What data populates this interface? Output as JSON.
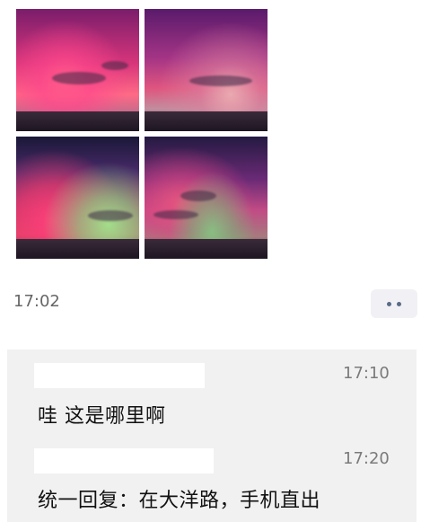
{
  "post": {
    "photos": [
      {
        "name": "aurora-photo-1"
      },
      {
        "name": "aurora-photo-2"
      },
      {
        "name": "aurora-photo-3"
      },
      {
        "name": "aurora-photo-4"
      }
    ],
    "time": "17:02",
    "more_icon": "more-dots-icon"
  },
  "comments": [
    {
      "time": "17:10",
      "text": "哇 这是哪里啊"
    },
    {
      "time": "17:20",
      "text": "统一回复：在大洋路，手机直出"
    }
  ]
}
